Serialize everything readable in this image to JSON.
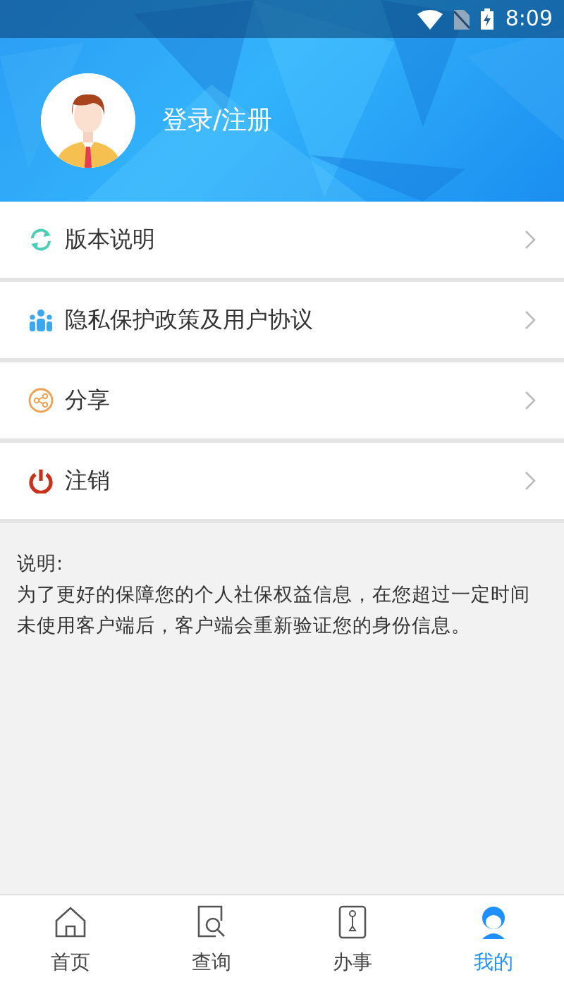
{
  "status_bar": {
    "time": "8:09"
  },
  "profile": {
    "login_text": "登录/注册"
  },
  "menu": [
    {
      "kind": "refresh",
      "label": "版本说明"
    },
    {
      "kind": "people",
      "label": "隐私保护政策及用户协议"
    },
    {
      "kind": "share",
      "label": "分享"
    },
    {
      "kind": "power",
      "label": "注销"
    }
  ],
  "notice": {
    "title": "说明:",
    "body": "为了更好的保障您的个人社保权益信息，在您超过一定时间未使用客户端后，客户端会重新验证您的身份信息。"
  },
  "bottom_nav": [
    {
      "kind": "home",
      "label": "首页",
      "selected": false
    },
    {
      "kind": "search",
      "label": "查询",
      "selected": false
    },
    {
      "kind": "task",
      "label": "办事",
      "selected": false
    },
    {
      "kind": "user",
      "label": "我的",
      "selected": true
    }
  ]
}
